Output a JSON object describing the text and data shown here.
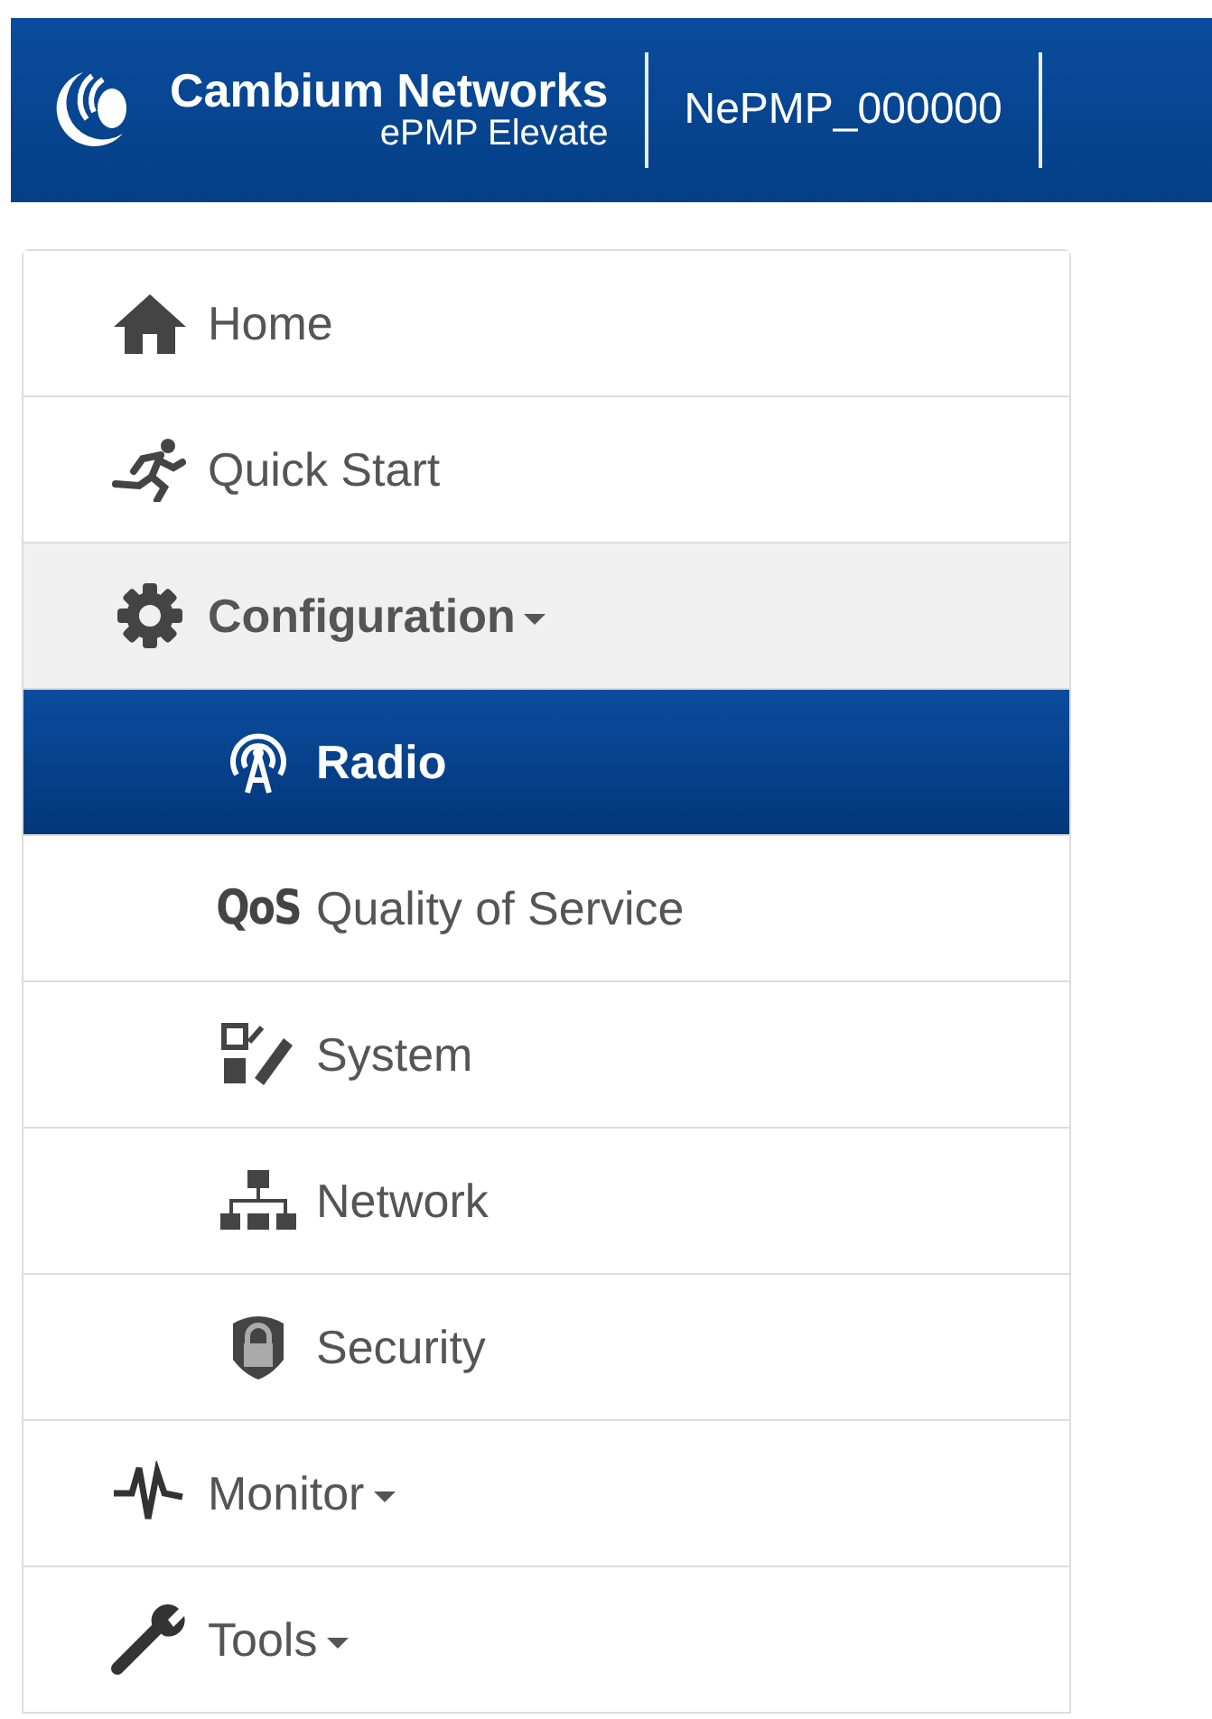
{
  "header": {
    "brand": "Cambium Networks",
    "product": "ePMP Elevate",
    "device_name": "NePMP_000000"
  },
  "menu": [
    {
      "label": "Home",
      "kind": "home",
      "has_submenu": false,
      "expanded": false,
      "selected": false
    },
    {
      "label": "Quick Start",
      "kind": "runner",
      "has_submenu": false,
      "expanded": false,
      "selected": false
    },
    {
      "label": "Configuration",
      "kind": "gear",
      "has_submenu": true,
      "expanded": true,
      "selected": false,
      "children": [
        {
          "label": "Radio",
          "kind": "radio",
          "selected": true
        },
        {
          "label": "Quality of Service",
          "kind": "qos",
          "icon_text": "QoS",
          "selected": false
        },
        {
          "label": "System",
          "kind": "system",
          "selected": false
        },
        {
          "label": "Network",
          "kind": "network",
          "selected": false
        },
        {
          "label": "Security",
          "kind": "security",
          "selected": false
        }
      ]
    },
    {
      "label": "Monitor",
      "kind": "monitor",
      "has_submenu": true,
      "expanded": false,
      "selected": false
    },
    {
      "label": "Tools",
      "kind": "wrench",
      "has_submenu": true,
      "expanded": false,
      "selected": false
    }
  ]
}
